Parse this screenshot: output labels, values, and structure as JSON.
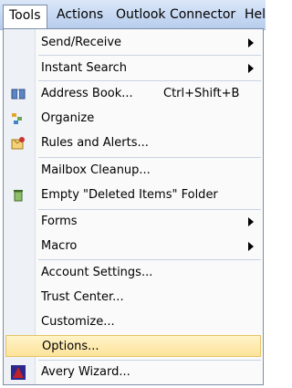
{
  "menubar": {
    "items": [
      "Tools",
      "Actions",
      "Outlook Connector",
      "Hel"
    ]
  },
  "menu": {
    "send_receive": "Send/Receive",
    "instant_search": "Instant Search",
    "address_book": "Address Book...",
    "address_book_shortcut": "Ctrl+Shift+B",
    "organize": "Organize",
    "rules_alerts": "Rules and Alerts...",
    "mailbox_cleanup": "Mailbox Cleanup...",
    "empty_deleted": "Empty \"Deleted Items\" Folder",
    "forms": "Forms",
    "macro": "Macro",
    "account_settings": "Account Settings...",
    "trust_center": "Trust Center...",
    "customize": "Customize...",
    "options": "Options...",
    "avery_wizard": "Avery Wizard..."
  },
  "colors": {
    "highlight": "#fde39a",
    "menubar": "#c6d8f2"
  },
  "icons": {
    "address_book": "book-icon",
    "organize": "organize-icon",
    "rules_alerts": "rules-icon",
    "empty_deleted": "recycle-bin-icon",
    "avery_wizard": "avery-icon"
  }
}
